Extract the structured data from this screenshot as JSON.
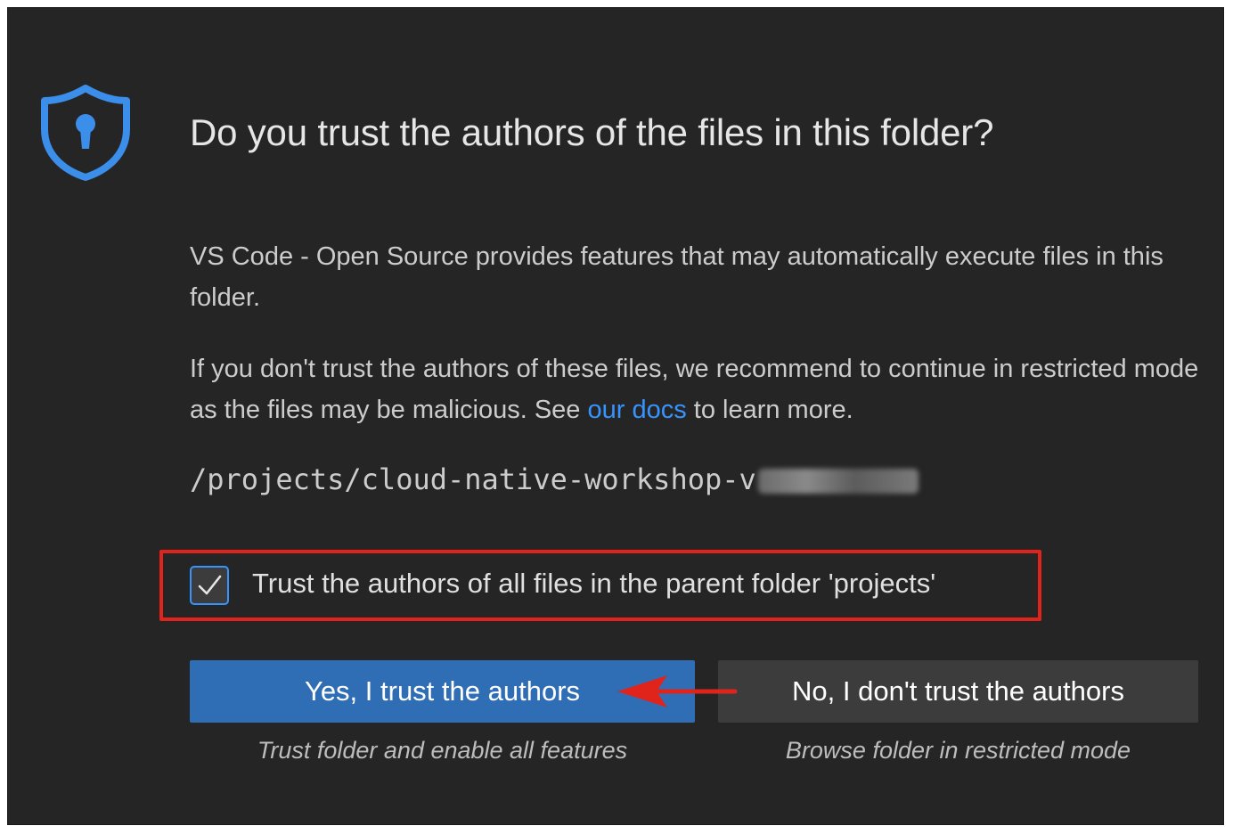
{
  "dialog": {
    "title": "Do you trust the authors of the files in this folder?",
    "paragraph1": "VS Code - Open Source provides features that may automatically execute files in this folder.",
    "paragraph2_before": "If you don't trust the authors of these files, we recommend to continue in restricted mode as the files may be malicious. See ",
    "paragraph2_link": "our docs",
    "paragraph2_after": " to learn more.",
    "folder_path": "/projects/cloud-native-workshop-v",
    "checkbox": {
      "label": "Trust the authors of all files in the parent folder 'projects'",
      "checked": true
    },
    "buttons": {
      "yes_label": "Yes, I trust the authors",
      "yes_subtitle": "Trust folder and enable all features",
      "no_label": "No, I don't trust the authors",
      "no_subtitle": "Browse folder in restricted mode"
    }
  },
  "icons": {
    "shield": "shield-lock-icon",
    "check": "check-icon",
    "annotation_arrow": "arrow-left-icon"
  },
  "colors": {
    "background": "#252526",
    "accent": "#3794ff",
    "primary_button": "#2f6db5",
    "secondary_button": "#3c3c3d",
    "annotation": "#e0241b"
  }
}
